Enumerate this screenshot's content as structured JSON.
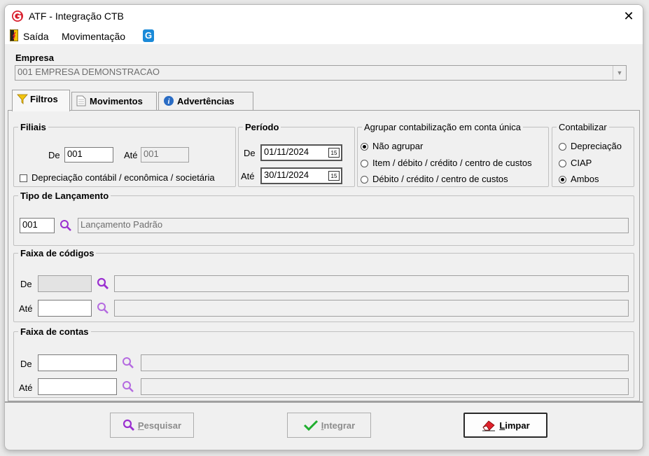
{
  "window": {
    "title": "ATF - Integração CTB",
    "close_symbol": "✕"
  },
  "menu": {
    "items": [
      "Saída",
      "Movimentação"
    ],
    "help_glyph": "G"
  },
  "empresa": {
    "label": "Empresa",
    "value": "001 EMPRESA DEMONSTRACAO"
  },
  "tabs": [
    {
      "label": "Filtros",
      "active": true
    },
    {
      "label": "Movimentos",
      "active": false
    },
    {
      "label": "Advertências",
      "active": false
    }
  ],
  "filiais": {
    "legend": "Filiais",
    "de_label": "De",
    "de_value": "001",
    "ate_label": "Até",
    "ate_value": "001",
    "checkbox_label": "Depreciação contábil / econômica / societária"
  },
  "periodo": {
    "legend": "Período",
    "de_label": "De",
    "de_value": "01/11/2024",
    "ate_label": "Até",
    "ate_value": "30/11/2024",
    "cal_glyph": "15"
  },
  "agrupar": {
    "legend": "Agrupar contabilização em conta única",
    "options": [
      "Não agrupar",
      "Item / débito / crédito / centro de custos",
      "Débito / crédito / centro de custos"
    ],
    "selected": 0
  },
  "contabilizar": {
    "legend": "Contabilizar",
    "options": [
      "Depreciação",
      "CIAP",
      "Ambos"
    ],
    "selected": 2
  },
  "tipo_lancamento": {
    "legend": "Tipo de Lançamento",
    "code": "001",
    "description": "Lançamento Padrão"
  },
  "faixa_codigos": {
    "legend": "Faixa de códigos",
    "de_label": "De",
    "de_value": "",
    "de_desc": "",
    "ate_label": "Até",
    "ate_value": "",
    "ate_desc": ""
  },
  "faixa_contas": {
    "legend": "Faixa de contas",
    "de_label": "De",
    "de_value": "",
    "de_desc": "",
    "ate_label": "Até",
    "ate_value": "",
    "ate_desc": ""
  },
  "buttons": {
    "pesquisar": "Pesquisar",
    "integrar": "Integrar",
    "limpar": "Limpar"
  },
  "colors": {
    "accent": "#d81e2c",
    "search": "#9a2fd0",
    "check": "#1fae2e",
    "help": "#1b8ad8"
  }
}
